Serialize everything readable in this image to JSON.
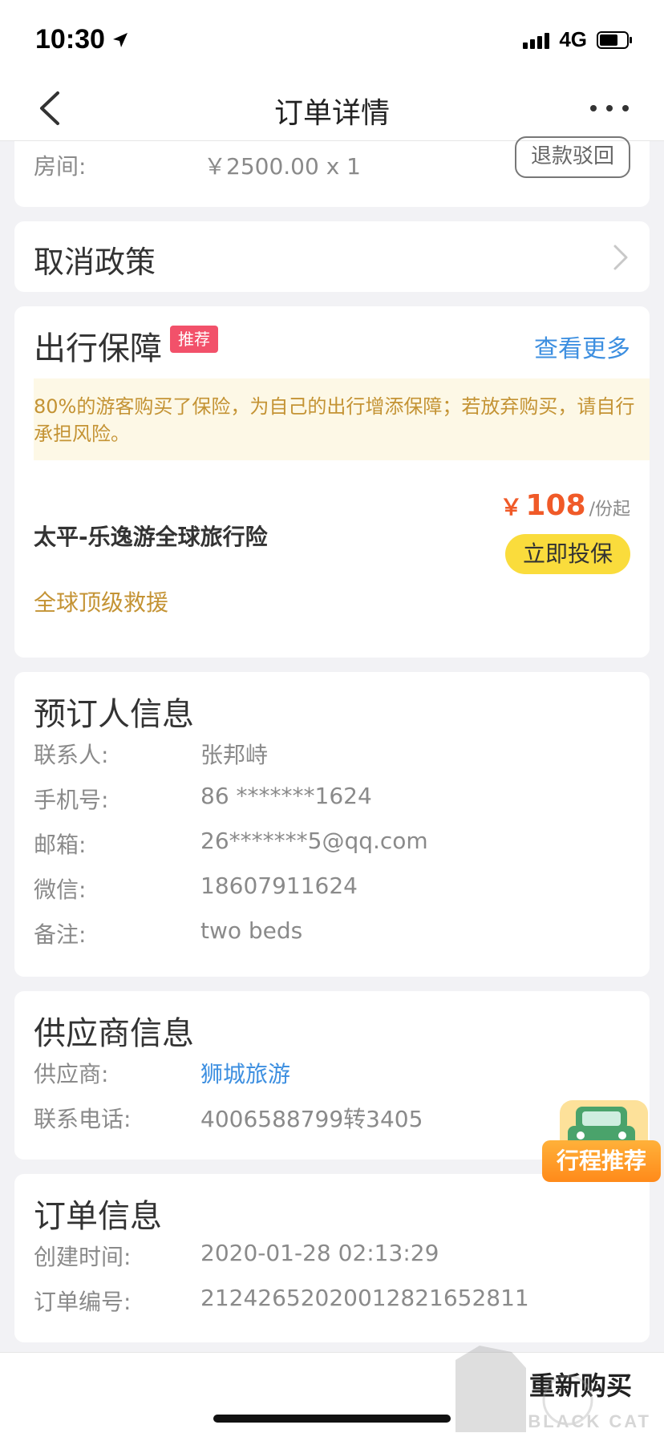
{
  "status_bar": {
    "time": "10:30",
    "network": "4G"
  },
  "nav": {
    "title": "订单详情"
  },
  "room": {
    "label": "房间:",
    "value": "￥2500.00 x 1",
    "refund_button": "退款驳回"
  },
  "cancel_policy": {
    "title": "取消政策"
  },
  "insurance": {
    "title": "出行保障",
    "badge": "推荐",
    "more_link": "查看更多",
    "notice": "80%的游客购买了保险，为自己的出行增添保障；若放弃购买，请自行承担风险。",
    "product_name": "太平-乐逸游全球旅行险",
    "price_symbol": "￥",
    "price": "108",
    "price_unit": "/份起",
    "buy_button": "立即投保",
    "feature": "全球顶级救援"
  },
  "booker": {
    "title": "预订人信息",
    "rows": [
      {
        "label": "联系人:",
        "value": "张邦峙"
      },
      {
        "label": "手机号:",
        "value": "86 *******1624"
      },
      {
        "label": "邮箱:",
        "value": "26*******5@qq.com"
      },
      {
        "label": "微信:",
        "value": "18607911624"
      },
      {
        "label": "备注:",
        "value": "two beds"
      }
    ]
  },
  "supplier": {
    "title": "供应商信息",
    "rows": [
      {
        "label": "供应商:",
        "value": "狮城旅游"
      },
      {
        "label": "联系电话:",
        "value": "4006588799转3405"
      }
    ]
  },
  "order": {
    "title": "订单信息",
    "rows": [
      {
        "label": "创建时间:",
        "value": "2020-01-28 02:13:29"
      },
      {
        "label": "订单编号:",
        "value": "2124265202001282165281​1"
      }
    ]
  },
  "trip_recommend": {
    "label": "行程推荐"
  },
  "bottom": {
    "rebuy_button": "重新购买"
  },
  "watermark": {
    "text": "BLACK CAT"
  },
  "colors": {
    "accent_blue": "#3d8fe0",
    "price_orange": "#f05a28",
    "buy_yellow": "#fadc3c",
    "badge_pink": "#f2516a",
    "notice_gold": "#c49334"
  }
}
